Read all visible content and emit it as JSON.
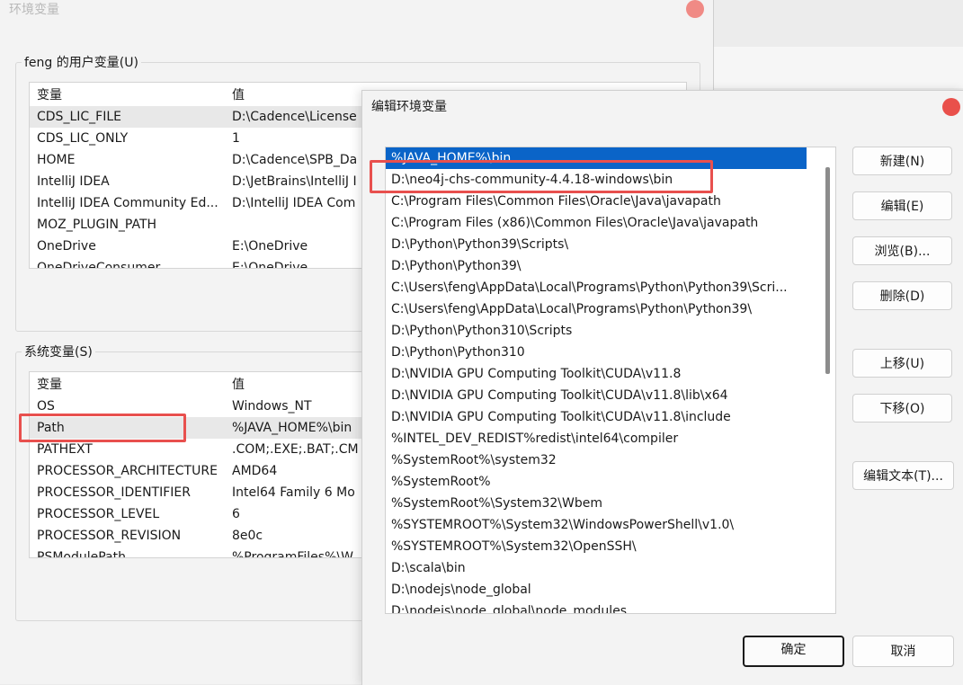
{
  "main_window": {
    "title": "环境变量",
    "user_group_label": "feng 的用户变量(U)",
    "system_group_label": "系统变量(S)",
    "columns": [
      "变量",
      "值"
    ],
    "user_vars": [
      {
        "name": "CDS_LIC_FILE",
        "value": "D:\\Cadence\\License"
      },
      {
        "name": "CDS_LIC_ONLY",
        "value": "1"
      },
      {
        "name": "HOME",
        "value": "D:\\Cadence\\SPB_Da"
      },
      {
        "name": "IntelliJ IDEA",
        "value": "D:\\JetBrains\\IntelliJ I"
      },
      {
        "name": "IntelliJ IDEA Community Ed...",
        "value": "D:\\IntelliJ IDEA Com"
      },
      {
        "name": "MOZ_PLUGIN_PATH",
        "value": ""
      },
      {
        "name": "OneDrive",
        "value": "E:\\OneDrive"
      },
      {
        "name": "OneDriveConsumer",
        "value": "E:\\OneDrive"
      }
    ],
    "system_vars": [
      {
        "name": "OS",
        "value": "Windows_NT"
      },
      {
        "name": "Path",
        "value": "%JAVA_HOME%\\bin"
      },
      {
        "name": "PATHEXT",
        "value": ".COM;.EXE;.BAT;.CM"
      },
      {
        "name": "PROCESSOR_ARCHITECTURE",
        "value": "AMD64"
      },
      {
        "name": "PROCESSOR_IDENTIFIER",
        "value": "Intel64 Family 6 Mo"
      },
      {
        "name": "PROCESSOR_LEVEL",
        "value": "6"
      },
      {
        "name": "PROCESSOR_REVISION",
        "value": "8e0c"
      },
      {
        "name": "PSModulePath",
        "value": "%ProgramFiles%\\W"
      }
    ]
  },
  "edit_dialog": {
    "title": "编辑环境变量",
    "paths": [
      "%JAVA_HOME%\\bin",
      "D:\\neo4j-chs-community-4.4.18-windows\\bin",
      "C:\\Program Files\\Common Files\\Oracle\\Java\\javapath",
      "C:\\Program Files (x86)\\Common Files\\Oracle\\Java\\javapath",
      "D:\\Python\\Python39\\Scripts\\",
      "D:\\Python\\Python39\\",
      "C:\\Users\\feng\\AppData\\Local\\Programs\\Python\\Python39\\Scri...",
      "C:\\Users\\feng\\AppData\\Local\\Programs\\Python\\Python39\\",
      "D:\\Python\\Python310\\Scripts",
      "D:\\Python\\Python310",
      "D:\\NVIDIA GPU Computing Toolkit\\CUDA\\v11.8",
      "D:\\NVIDIA GPU Computing Toolkit\\CUDA\\v11.8\\lib\\x64",
      "D:\\NVIDIA GPU Computing Toolkit\\CUDA\\v11.8\\include",
      "%INTEL_DEV_REDIST%redist\\intel64\\compiler",
      "%SystemRoot%\\system32",
      "%SystemRoot%",
      "%SystemRoot%\\System32\\Wbem",
      "%SYSTEMROOT%\\System32\\WindowsPowerShell\\v1.0\\",
      "%SYSTEMROOT%\\System32\\OpenSSH\\",
      "D:\\scala\\bin",
      "D:\\nodejs\\node_global",
      "D:\\nodejs\\node_global\\node_modules"
    ],
    "buttons": {
      "new": "新建(N)",
      "edit": "编辑(E)",
      "browse": "浏览(B)...",
      "delete": "删除(D)",
      "move_up": "上移(U)",
      "move_down": "下移(O)",
      "edit_text": "编辑文本(T)...",
      "ok": "确定",
      "cancel": "取消"
    }
  }
}
